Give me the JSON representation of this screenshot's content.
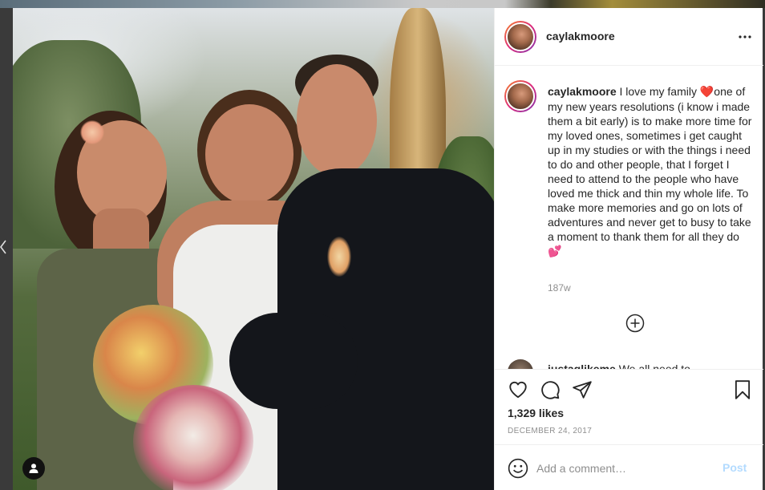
{
  "post": {
    "username": "caylakmoore",
    "menu_icon": "more-horizontal-icon",
    "caption": {
      "username": "caylakmoore",
      "text_before_heart": " I love my family ",
      "heart_emoji": "❤️",
      "text_after_heart": "one of my new years resolutions (i know i made them a bit early) is to make more time for my loved ones, sometimes i get caught up in my studies or with the things i need to do and other people, that I forget I need to attend to the people who have loved me thick and thin my whole life. To make more memories and go on lots of adventures and never get to busy to take a moment to thank them for all they do ",
      "end_emoji": "💕"
    },
    "time_ago": "187w",
    "load_more_icon": "plus-circle-icon",
    "next_comment": {
      "username": "justaglikeme",
      "text": " We all need to"
    },
    "actions": {
      "like_icon": "heart-outline-icon",
      "comment_icon": "comment-bubble-icon",
      "share_icon": "paper-plane-icon",
      "save_icon": "bookmark-icon"
    },
    "likes": "1,329 likes",
    "date": "DECEMBER 24, 2017",
    "comment_box": {
      "emoji_icon": "smiley-icon",
      "placeholder": "Add a comment…",
      "post_label": "Post"
    }
  },
  "colors": {
    "text": "#262626",
    "muted": "#8e8e8e",
    "border": "#efefef",
    "post_disabled": "#b3dbff",
    "heart": "#e0245e"
  }
}
